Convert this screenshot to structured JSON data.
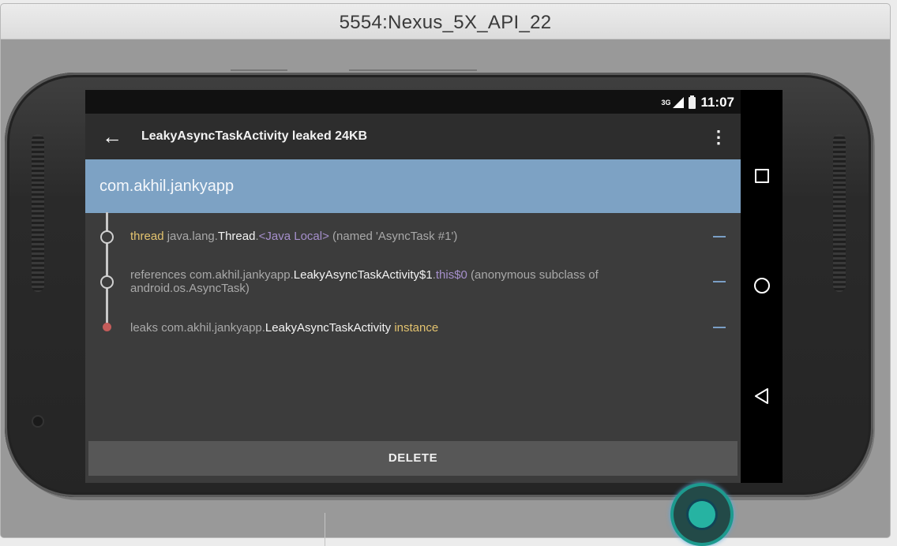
{
  "window": {
    "title": "5554:Nexus_5X_API_22"
  },
  "statusbar": {
    "network": "3G",
    "time": "11:07"
  },
  "toolbar": {
    "back_icon": "←",
    "title": "LeakyAsyncTaskActivity leaked 24KB",
    "overflow_icon": "⋮"
  },
  "header": {
    "package": "com.akhil.jankyapp"
  },
  "trace": [
    {
      "parts": [
        {
          "text": "thread ",
          "color": "yellow"
        },
        {
          "text": "java.lang.",
          "color": "gray"
        },
        {
          "text": "Thread",
          "color": "white"
        },
        {
          "text": ".",
          "color": "gray"
        },
        {
          "text": "<Java Local>",
          "color": "purple"
        },
        {
          "text": " (named 'AsyncTask #1')",
          "color": "gray"
        }
      ]
    },
    {
      "parts": [
        {
          "text": "references ",
          "color": "gray"
        },
        {
          "text": "com.akhil.jankyapp.",
          "color": "gray"
        },
        {
          "text": "LeakyAsyncTaskActivity$1",
          "color": "white"
        },
        {
          "text": ".",
          "color": "gray"
        },
        {
          "text": "this$0",
          "color": "purple"
        },
        {
          "text": " (anonymous subclass of android.os.AsyncTask)",
          "color": "gray"
        }
      ]
    },
    {
      "parts": [
        {
          "text": "leaks ",
          "color": "gray"
        },
        {
          "text": "com.akhil.jankyapp.",
          "color": "gray"
        },
        {
          "text": "LeakyAsyncTaskActivity",
          "color": "white"
        },
        {
          "text": " instance",
          "color": "yellow"
        }
      ]
    }
  ],
  "delete_label": "DELETE",
  "nav": {
    "recents_icon": "square-icon",
    "home_icon": "circle-icon",
    "back_icon": "triangle-icon"
  },
  "colors": {
    "header": "#7da2c4",
    "yellow": "#e3c36f",
    "purple": "#a690cc",
    "leak_node": "#c45c5a",
    "fab": "#1d9a8e"
  }
}
